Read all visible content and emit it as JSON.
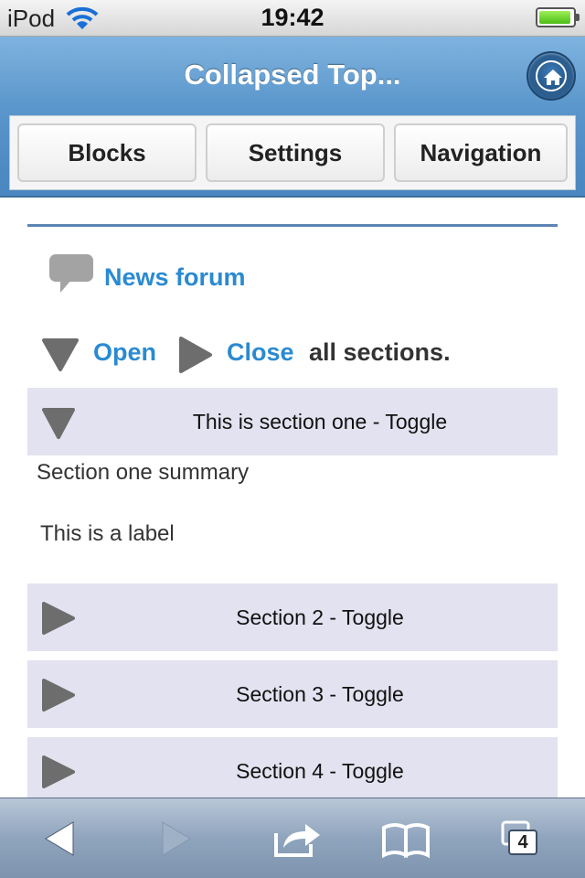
{
  "status_bar": {
    "carrier": "iPod",
    "time": "19:42"
  },
  "header": {
    "title": "Collapsed Top...",
    "home_icon": "home-icon"
  },
  "nav": {
    "blocks_label": "Blocks",
    "settings_label": "Settings",
    "navigation_label": "Navigation"
  },
  "content": {
    "news_forum_link": "News forum",
    "open_label": "Open",
    "close_label": "Close",
    "all_sections_text": "all sections.",
    "sections": [
      {
        "title": "This is section one - Toggle",
        "expanded": true
      },
      {
        "title": "Section 2 - Toggle",
        "expanded": false
      },
      {
        "title": "Section 3 - Toggle",
        "expanded": false
      },
      {
        "title": "Section 4 - Toggle",
        "expanded": false
      }
    ],
    "section_one_summary": "Section one summary",
    "label_text": "This is a label"
  },
  "toolbar": {
    "tabs_count": "4"
  },
  "colors": {
    "link_blue": "#2a8ad1",
    "header_blue": "#5a96cb",
    "section_bg": "#e3e2f0",
    "rule_blue": "#5c84b4"
  }
}
